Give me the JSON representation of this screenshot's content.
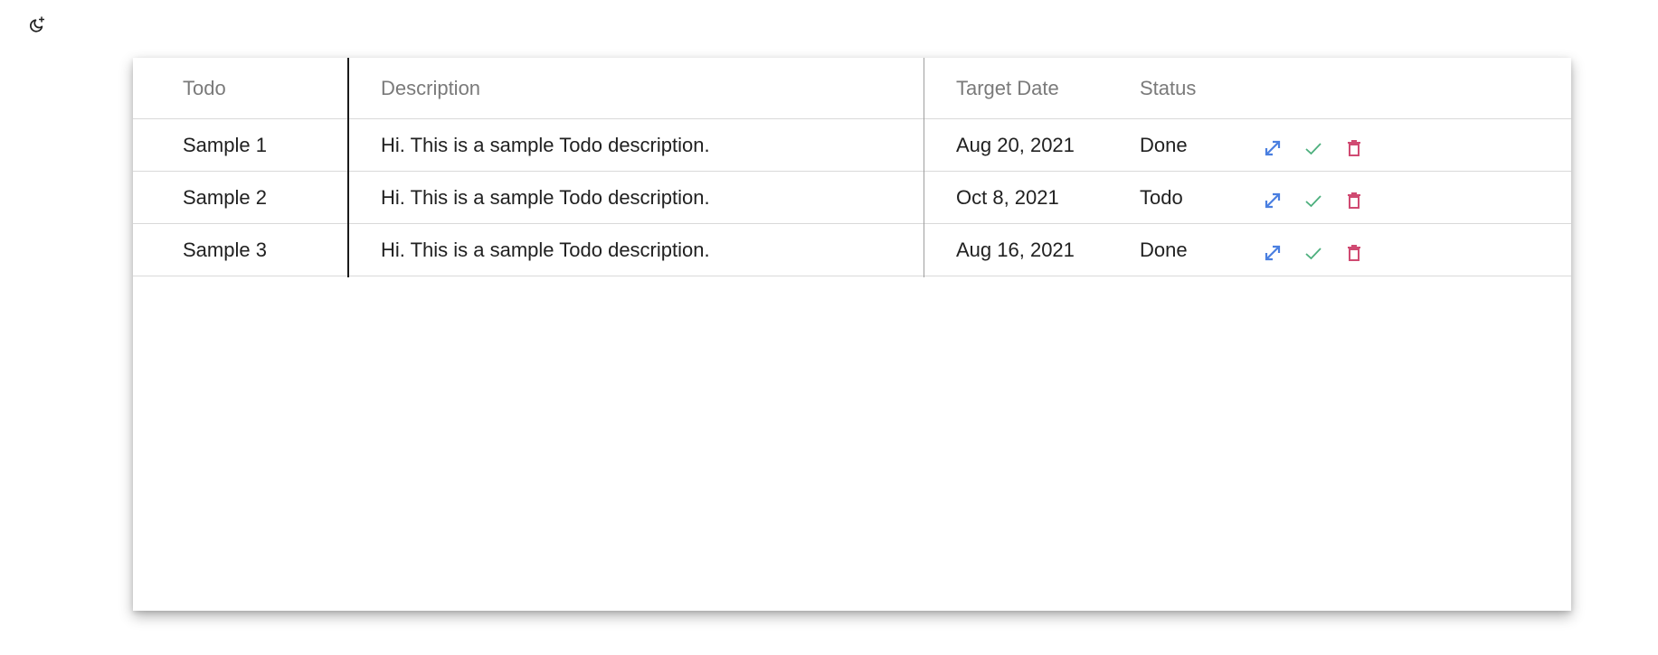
{
  "theme_toggle": {
    "icon": "theme-toggle-icon"
  },
  "table": {
    "columns": [
      "Todo",
      "Description",
      "Target Date",
      "Status"
    ],
    "rows": [
      {
        "todo": "Sample 1",
        "description": "Hi. This is a sample Todo description.",
        "target_date": "Aug 20, 2021",
        "status": "Done"
      },
      {
        "todo": "Sample 2",
        "description": "Hi. This is a sample Todo description.",
        "target_date": "Oct 8, 2021",
        "status": "Todo"
      },
      {
        "todo": "Sample 3",
        "description": "Hi. This is a sample Todo description.",
        "target_date": "Aug 16, 2021",
        "status": "Done"
      }
    ],
    "row_actions": [
      {
        "icon": "expand-icon",
        "color": "#4a7fe0"
      },
      {
        "icon": "check-icon",
        "color": "#4caf7d"
      },
      {
        "icon": "trash-icon",
        "color": "#d04a72"
      }
    ]
  },
  "colors": {
    "header_text": "#7a7a7a",
    "body_text": "#212121",
    "expand": "#4a7fe0",
    "check": "#4caf7d",
    "delete": "#d04a72"
  }
}
